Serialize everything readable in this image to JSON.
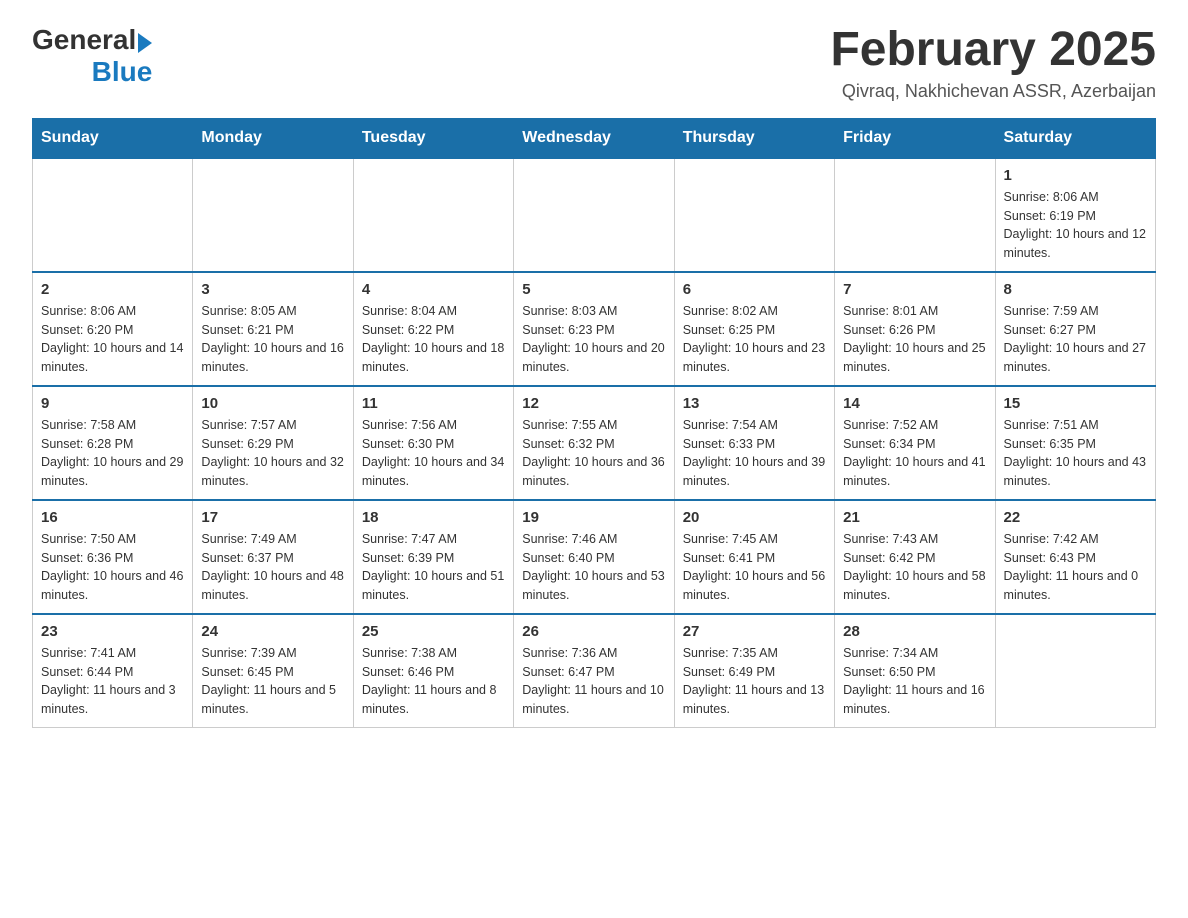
{
  "header": {
    "logo_general": "General",
    "logo_blue": "Blue",
    "title": "February 2025",
    "subtitle": "Qivraq, Nakhichevan ASSR, Azerbaijan"
  },
  "calendar": {
    "days_of_week": [
      "Sunday",
      "Monday",
      "Tuesday",
      "Wednesday",
      "Thursday",
      "Friday",
      "Saturday"
    ],
    "weeks": [
      [
        {
          "day": "",
          "info": ""
        },
        {
          "day": "",
          "info": ""
        },
        {
          "day": "",
          "info": ""
        },
        {
          "day": "",
          "info": ""
        },
        {
          "day": "",
          "info": ""
        },
        {
          "day": "",
          "info": ""
        },
        {
          "day": "1",
          "info": "Sunrise: 8:06 AM\nSunset: 6:19 PM\nDaylight: 10 hours and 12 minutes."
        }
      ],
      [
        {
          "day": "2",
          "info": "Sunrise: 8:06 AM\nSunset: 6:20 PM\nDaylight: 10 hours and 14 minutes."
        },
        {
          "day": "3",
          "info": "Sunrise: 8:05 AM\nSunset: 6:21 PM\nDaylight: 10 hours and 16 minutes."
        },
        {
          "day": "4",
          "info": "Sunrise: 8:04 AM\nSunset: 6:22 PM\nDaylight: 10 hours and 18 minutes."
        },
        {
          "day": "5",
          "info": "Sunrise: 8:03 AM\nSunset: 6:23 PM\nDaylight: 10 hours and 20 minutes."
        },
        {
          "day": "6",
          "info": "Sunrise: 8:02 AM\nSunset: 6:25 PM\nDaylight: 10 hours and 23 minutes."
        },
        {
          "day": "7",
          "info": "Sunrise: 8:01 AM\nSunset: 6:26 PM\nDaylight: 10 hours and 25 minutes."
        },
        {
          "day": "8",
          "info": "Sunrise: 7:59 AM\nSunset: 6:27 PM\nDaylight: 10 hours and 27 minutes."
        }
      ],
      [
        {
          "day": "9",
          "info": "Sunrise: 7:58 AM\nSunset: 6:28 PM\nDaylight: 10 hours and 29 minutes."
        },
        {
          "day": "10",
          "info": "Sunrise: 7:57 AM\nSunset: 6:29 PM\nDaylight: 10 hours and 32 minutes."
        },
        {
          "day": "11",
          "info": "Sunrise: 7:56 AM\nSunset: 6:30 PM\nDaylight: 10 hours and 34 minutes."
        },
        {
          "day": "12",
          "info": "Sunrise: 7:55 AM\nSunset: 6:32 PM\nDaylight: 10 hours and 36 minutes."
        },
        {
          "day": "13",
          "info": "Sunrise: 7:54 AM\nSunset: 6:33 PM\nDaylight: 10 hours and 39 minutes."
        },
        {
          "day": "14",
          "info": "Sunrise: 7:52 AM\nSunset: 6:34 PM\nDaylight: 10 hours and 41 minutes."
        },
        {
          "day": "15",
          "info": "Sunrise: 7:51 AM\nSunset: 6:35 PM\nDaylight: 10 hours and 43 minutes."
        }
      ],
      [
        {
          "day": "16",
          "info": "Sunrise: 7:50 AM\nSunset: 6:36 PM\nDaylight: 10 hours and 46 minutes."
        },
        {
          "day": "17",
          "info": "Sunrise: 7:49 AM\nSunset: 6:37 PM\nDaylight: 10 hours and 48 minutes."
        },
        {
          "day": "18",
          "info": "Sunrise: 7:47 AM\nSunset: 6:39 PM\nDaylight: 10 hours and 51 minutes."
        },
        {
          "day": "19",
          "info": "Sunrise: 7:46 AM\nSunset: 6:40 PM\nDaylight: 10 hours and 53 minutes."
        },
        {
          "day": "20",
          "info": "Sunrise: 7:45 AM\nSunset: 6:41 PM\nDaylight: 10 hours and 56 minutes."
        },
        {
          "day": "21",
          "info": "Sunrise: 7:43 AM\nSunset: 6:42 PM\nDaylight: 10 hours and 58 minutes."
        },
        {
          "day": "22",
          "info": "Sunrise: 7:42 AM\nSunset: 6:43 PM\nDaylight: 11 hours and 0 minutes."
        }
      ],
      [
        {
          "day": "23",
          "info": "Sunrise: 7:41 AM\nSunset: 6:44 PM\nDaylight: 11 hours and 3 minutes."
        },
        {
          "day": "24",
          "info": "Sunrise: 7:39 AM\nSunset: 6:45 PM\nDaylight: 11 hours and 5 minutes."
        },
        {
          "day": "25",
          "info": "Sunrise: 7:38 AM\nSunset: 6:46 PM\nDaylight: 11 hours and 8 minutes."
        },
        {
          "day": "26",
          "info": "Sunrise: 7:36 AM\nSunset: 6:47 PM\nDaylight: 11 hours and 10 minutes."
        },
        {
          "day": "27",
          "info": "Sunrise: 7:35 AM\nSunset: 6:49 PM\nDaylight: 11 hours and 13 minutes."
        },
        {
          "day": "28",
          "info": "Sunrise: 7:34 AM\nSunset: 6:50 PM\nDaylight: 11 hours and 16 minutes."
        },
        {
          "day": "",
          "info": ""
        }
      ]
    ]
  }
}
